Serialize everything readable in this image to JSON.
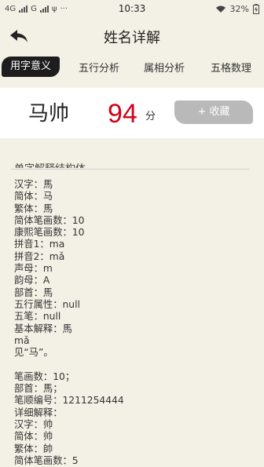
{
  "statusbar": {
    "left_text": "4G",
    "carrier": "G",
    "time": "10:33",
    "battery": "32%"
  },
  "navbar": {
    "title": "姓名详解"
  },
  "tabs": [
    {
      "label": "用字意义"
    },
    {
      "label": "五行分析"
    },
    {
      "label": "属相分析"
    },
    {
      "label": "五格数理"
    }
  ],
  "header": {
    "name": "马帅",
    "score": "94",
    "score_unit": "分",
    "favorite_label": "+ 收藏"
  },
  "section": {
    "title": "单字解释结构体"
  },
  "details": {
    "lines": [
      "汉字：馬",
      "简体：马",
      "繁体：馬",
      "简体笔画数：10",
      "康熙笔画数：10",
      "拼音1：ma",
      "拼音2：mǎ",
      "声母：m",
      "韵母：A",
      "部首：馬",
      "五行属性：null",
      "五笔：null",
      "基本解释：馬",
      "mǎ",
      "见“马”。",
      "",
      "笔画数：10；",
      "部首：馬；",
      "笔顺编号：1211254444",
      "详细解释：",
      "汉字：帅",
      "简体：帅",
      "繁体：帥",
      "简体笔画数：5"
    ]
  }
}
